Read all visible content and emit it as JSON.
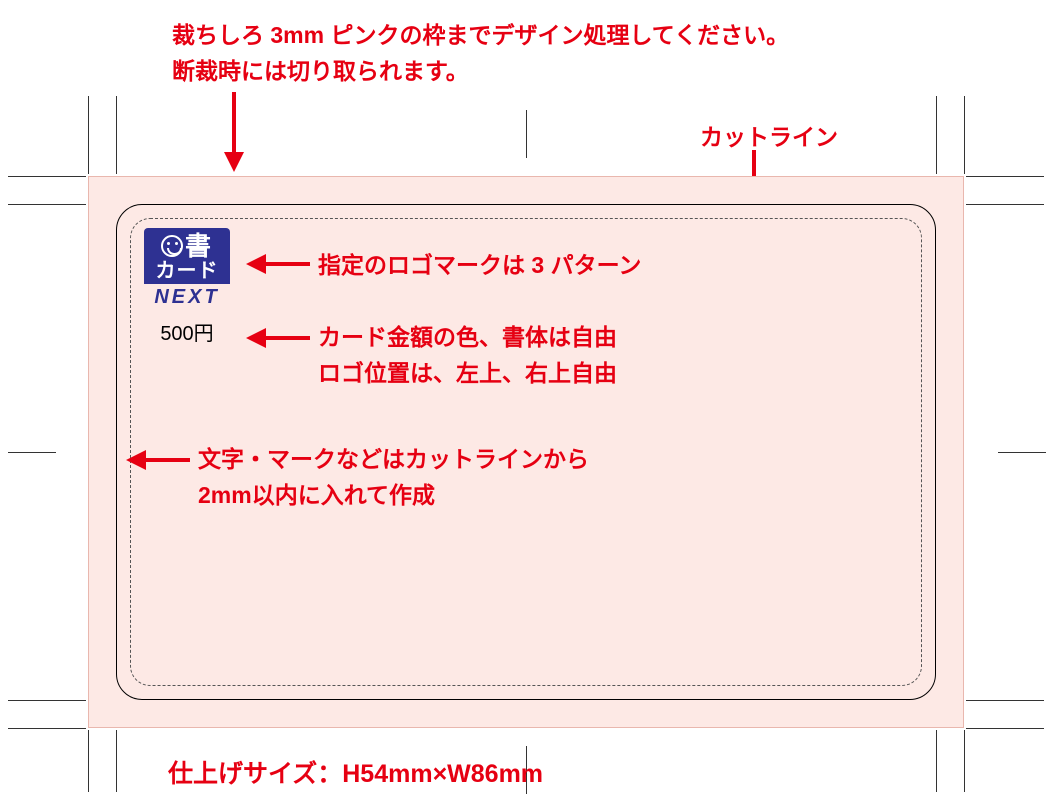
{
  "annotations": {
    "bleed_line1": "裁ちしろ 3mm ピンクの枠までデザイン処理してください。",
    "bleed_line2": "断裁時には切り取られます。",
    "cutline_label": "カットライン",
    "logo_note": "指定のロゴマークは 3 パターン",
    "amount_note_line1": "カード金額の色、書体は自由",
    "amount_note_line2": "ロゴ位置は、左上、右上自由",
    "safezone_line1": "文字・マークなどはカットラインから",
    "safezone_line2": "2mm以内に入れて作成",
    "finish_size": "仕上げサイズ：H54mm×W86mm"
  },
  "logo": {
    "row1_kanji": "書",
    "row2_text": "カード",
    "next_text": "NEXT",
    "amount": "500円"
  },
  "colors": {
    "annotation_red": "#e60012",
    "logo_navy": "#2e3192",
    "bleed_pink": "#fde9e5"
  }
}
